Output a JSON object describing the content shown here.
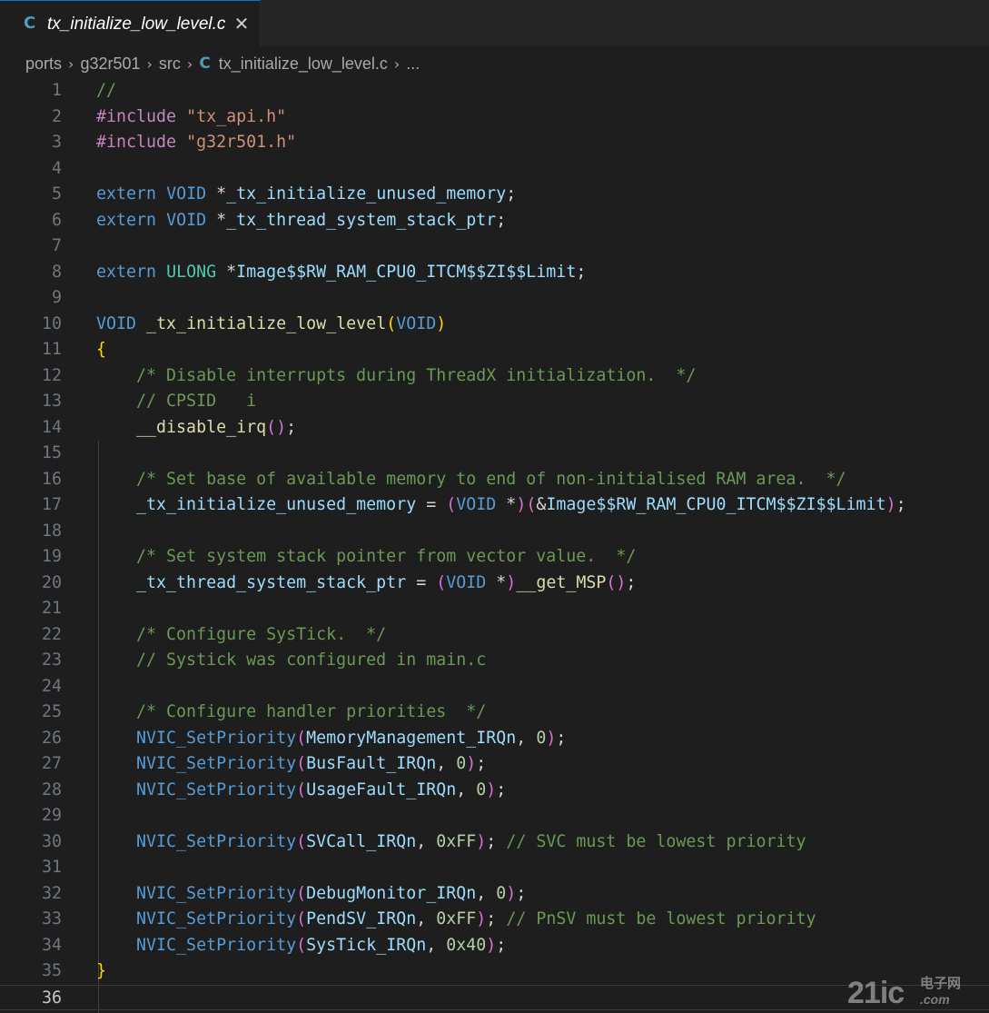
{
  "tab": {
    "icon": "C",
    "title": "tx_initialize_low_level.c",
    "close": "✕"
  },
  "breadcrumb": {
    "items": [
      "ports",
      "g32r501",
      "src"
    ],
    "file_icon": "C",
    "file": "tx_initialize_low_level.c",
    "ellipsis": "..."
  },
  "colors": {
    "comment": "#6a9955",
    "keyword": "#569cd6",
    "preprocessor": "#c586c0",
    "string": "#ce9178",
    "type": "#4ec9b0",
    "identifier": "#9cdcfe",
    "function": "#dcdcaa",
    "number": "#b5cea8",
    "bracket_gold": "#ffd700",
    "bracket_pink": "#da70d6",
    "bracket_blue": "#179fff",
    "plain": "#d4d4d4"
  },
  "current_line": 36,
  "lines": [
    [
      {
        "t": "//",
        "c": "comment"
      }
    ],
    [
      {
        "t": "#include",
        "c": "preprocessor"
      },
      {
        "t": " ",
        "c": "plain"
      },
      {
        "t": "\"tx_api.h\"",
        "c": "string"
      }
    ],
    [
      {
        "t": "#include",
        "c": "preprocessor"
      },
      {
        "t": " ",
        "c": "plain"
      },
      {
        "t": "\"g32r501.h\"",
        "c": "string"
      }
    ],
    [],
    [
      {
        "t": "extern",
        "c": "keyword"
      },
      {
        "t": " ",
        "c": "plain"
      },
      {
        "t": "VOID",
        "c": "keyword"
      },
      {
        "t": " *",
        "c": "plain"
      },
      {
        "t": "_tx_initialize_unused_memory",
        "c": "identifier"
      },
      {
        "t": ";",
        "c": "plain"
      }
    ],
    [
      {
        "t": "extern",
        "c": "keyword"
      },
      {
        "t": " ",
        "c": "plain"
      },
      {
        "t": "VOID",
        "c": "keyword"
      },
      {
        "t": " *",
        "c": "plain"
      },
      {
        "t": "_tx_thread_system_stack_ptr",
        "c": "identifier"
      },
      {
        "t": ";",
        "c": "plain"
      }
    ],
    [],
    [
      {
        "t": "extern",
        "c": "keyword"
      },
      {
        "t": " ",
        "c": "plain"
      },
      {
        "t": "ULONG",
        "c": "type"
      },
      {
        "t": " *",
        "c": "plain"
      },
      {
        "t": "Image$$RW_RAM_CPU0_ITCM$$ZI$$Limit",
        "c": "identifier"
      },
      {
        "t": ";",
        "c": "plain"
      }
    ],
    [],
    [
      {
        "t": "VOID",
        "c": "keyword"
      },
      {
        "t": " ",
        "c": "plain"
      },
      {
        "t": "_tx_initialize_low_level",
        "c": "function"
      },
      {
        "t": "(",
        "c": "bracket_gold"
      },
      {
        "t": "VOID",
        "c": "keyword"
      },
      {
        "t": ")",
        "c": "bracket_gold"
      }
    ],
    [
      {
        "t": "{",
        "c": "bracket_gold"
      }
    ],
    [
      {
        "t": "    ",
        "c": "plain"
      },
      {
        "t": "/* Disable interrupts during ThreadX initialization.  */",
        "c": "comment"
      }
    ],
    [
      {
        "t": "    ",
        "c": "plain"
      },
      {
        "t": "// CPSID   i",
        "c": "comment"
      }
    ],
    [
      {
        "t": "    ",
        "c": "plain"
      },
      {
        "t": "__disable_irq",
        "c": "function"
      },
      {
        "t": "()",
        "c": "bracket_pink"
      },
      {
        "t": ";",
        "c": "plain"
      }
    ],
    [],
    [
      {
        "t": "    ",
        "c": "plain"
      },
      {
        "t": "/* Set base of available memory to end of non-initialised RAM area.  */",
        "c": "comment"
      }
    ],
    [
      {
        "t": "    ",
        "c": "plain"
      },
      {
        "t": "_tx_initialize_unused_memory",
        "c": "identifier"
      },
      {
        "t": " = ",
        "c": "plain"
      },
      {
        "t": "(",
        "c": "bracket_pink"
      },
      {
        "t": "VOID",
        "c": "keyword"
      },
      {
        "t": " *",
        "c": "plain"
      },
      {
        "t": ")(",
        "c": "bracket_pink"
      },
      {
        "t": "&",
        "c": "plain"
      },
      {
        "t": "Image$$RW_RAM_CPU0_ITCM$$ZI$$Limit",
        "c": "identifier"
      },
      {
        "t": ")",
        "c": "bracket_pink"
      },
      {
        "t": ";",
        "c": "plain"
      }
    ],
    [],
    [
      {
        "t": "    ",
        "c": "plain"
      },
      {
        "t": "/* Set system stack pointer from vector value.  */",
        "c": "comment"
      }
    ],
    [
      {
        "t": "    ",
        "c": "plain"
      },
      {
        "t": "_tx_thread_system_stack_ptr",
        "c": "identifier"
      },
      {
        "t": " = ",
        "c": "plain"
      },
      {
        "t": "(",
        "c": "bracket_pink"
      },
      {
        "t": "VOID",
        "c": "keyword"
      },
      {
        "t": " *",
        "c": "plain"
      },
      {
        "t": ")",
        "c": "bracket_pink"
      },
      {
        "t": "__get_MSP",
        "c": "function"
      },
      {
        "t": "()",
        "c": "bracket_pink"
      },
      {
        "t": ";",
        "c": "plain"
      }
    ],
    [],
    [
      {
        "t": "    ",
        "c": "plain"
      },
      {
        "t": "/* Configure SysTick.  */",
        "c": "comment"
      }
    ],
    [
      {
        "t": "    ",
        "c": "plain"
      },
      {
        "t": "// Systick was configured in main.c",
        "c": "comment"
      }
    ],
    [],
    [
      {
        "t": "    ",
        "c": "plain"
      },
      {
        "t": "/* Configure handler priorities  */",
        "c": "comment"
      }
    ],
    [
      {
        "t": "    ",
        "c": "plain"
      },
      {
        "t": "NVIC_SetPriority",
        "c": "keyword"
      },
      {
        "t": "(",
        "c": "bracket_pink"
      },
      {
        "t": "MemoryManagement_IRQn",
        "c": "identifier"
      },
      {
        "t": ", ",
        "c": "plain"
      },
      {
        "t": "0",
        "c": "number"
      },
      {
        "t": ")",
        "c": "bracket_pink"
      },
      {
        "t": ";",
        "c": "plain"
      }
    ],
    [
      {
        "t": "    ",
        "c": "plain"
      },
      {
        "t": "NVIC_SetPriority",
        "c": "keyword"
      },
      {
        "t": "(",
        "c": "bracket_pink"
      },
      {
        "t": "BusFault_IRQn",
        "c": "identifier"
      },
      {
        "t": ", ",
        "c": "plain"
      },
      {
        "t": "0",
        "c": "number"
      },
      {
        "t": ")",
        "c": "bracket_pink"
      },
      {
        "t": ";",
        "c": "plain"
      }
    ],
    [
      {
        "t": "    ",
        "c": "plain"
      },
      {
        "t": "NVIC_SetPriority",
        "c": "keyword"
      },
      {
        "t": "(",
        "c": "bracket_pink"
      },
      {
        "t": "UsageFault_IRQn",
        "c": "identifier"
      },
      {
        "t": ", ",
        "c": "plain"
      },
      {
        "t": "0",
        "c": "number"
      },
      {
        "t": ")",
        "c": "bracket_pink"
      },
      {
        "t": ";",
        "c": "plain"
      }
    ],
    [],
    [
      {
        "t": "    ",
        "c": "plain"
      },
      {
        "t": "NVIC_SetPriority",
        "c": "keyword"
      },
      {
        "t": "(",
        "c": "bracket_pink"
      },
      {
        "t": "SVCall_IRQn",
        "c": "identifier"
      },
      {
        "t": ", ",
        "c": "plain"
      },
      {
        "t": "0xFF",
        "c": "number"
      },
      {
        "t": ")",
        "c": "bracket_pink"
      },
      {
        "t": "; ",
        "c": "plain"
      },
      {
        "t": "// SVC must be lowest priority",
        "c": "comment"
      }
    ],
    [],
    [
      {
        "t": "    ",
        "c": "plain"
      },
      {
        "t": "NVIC_SetPriority",
        "c": "keyword"
      },
      {
        "t": "(",
        "c": "bracket_pink"
      },
      {
        "t": "DebugMonitor_IRQn",
        "c": "identifier"
      },
      {
        "t": ", ",
        "c": "plain"
      },
      {
        "t": "0",
        "c": "number"
      },
      {
        "t": ")",
        "c": "bracket_pink"
      },
      {
        "t": ";",
        "c": "plain"
      }
    ],
    [
      {
        "t": "    ",
        "c": "plain"
      },
      {
        "t": "NVIC_SetPriority",
        "c": "keyword"
      },
      {
        "t": "(",
        "c": "bracket_pink"
      },
      {
        "t": "PendSV_IRQn",
        "c": "identifier"
      },
      {
        "t": ", ",
        "c": "plain"
      },
      {
        "t": "0xFF",
        "c": "number"
      },
      {
        "t": ")",
        "c": "bracket_pink"
      },
      {
        "t": "; ",
        "c": "plain"
      },
      {
        "t": "// PnSV must be lowest priority",
        "c": "comment"
      }
    ],
    [
      {
        "t": "    ",
        "c": "plain"
      },
      {
        "t": "NVIC_SetPriority",
        "c": "keyword"
      },
      {
        "t": "(",
        "c": "bracket_pink"
      },
      {
        "t": "SysTick_IRQn",
        "c": "identifier"
      },
      {
        "t": ", ",
        "c": "plain"
      },
      {
        "t": "0x40",
        "c": "number"
      },
      {
        "t": ")",
        "c": "bracket_pink"
      },
      {
        "t": ";",
        "c": "plain"
      }
    ],
    [
      {
        "t": "}",
        "c": "bracket_gold"
      }
    ],
    []
  ],
  "watermark": {
    "main": "21ic",
    "top": "电子网",
    "sub": ".com"
  }
}
